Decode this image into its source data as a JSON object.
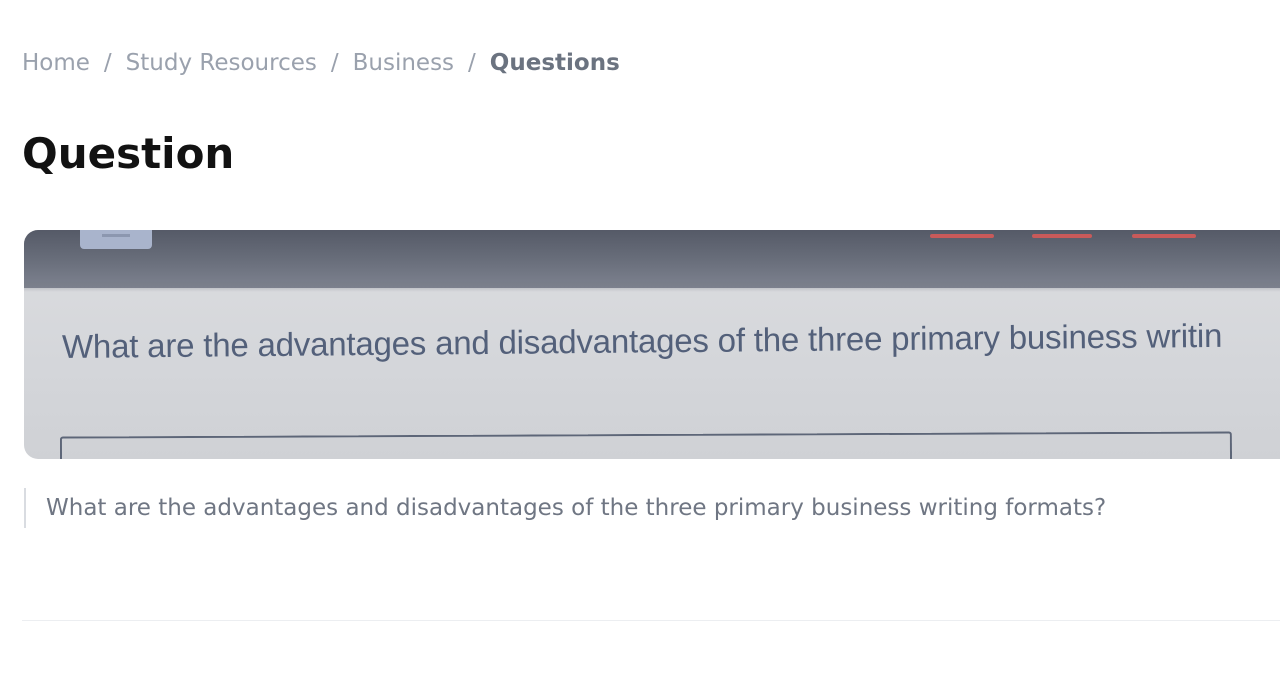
{
  "breadcrumb": {
    "home": "Home",
    "study_resources": "Study Resources",
    "business": "Business",
    "current": "Questions",
    "separator": "/"
  },
  "page_title": "Question",
  "question_image": {
    "visible_text": "What are the advantages and disadvantages of the three primary business writin"
  },
  "question": {
    "text": "What are the advantages and disadvantages of the three primary business writing formats?"
  },
  "colors": {
    "title": "#121212",
    "breadcrumb": "#9aa1ad",
    "breadcrumb_current": "#6b7380",
    "question_text": "#6f7683",
    "photo_bezel": "#5f6471",
    "photo_screen": "#d6d8dc"
  }
}
